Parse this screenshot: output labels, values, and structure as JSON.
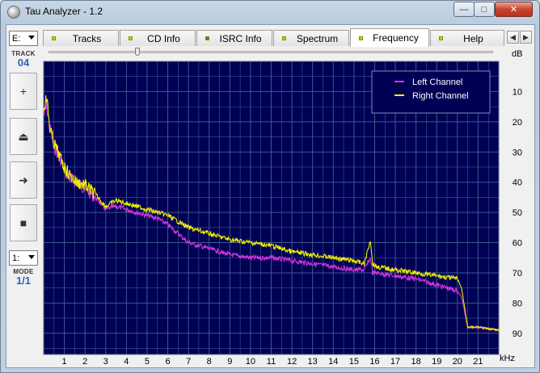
{
  "window": {
    "title": "Tau Analyzer - 1.2"
  },
  "left_panel": {
    "drive": "E:",
    "track_label": "TRACK",
    "track_value": "04",
    "buttons": [
      {
        "name": "plus",
        "glyph": "+"
      },
      {
        "name": "eject",
        "glyph": "⏏"
      },
      {
        "name": "next",
        "glyph": "➜"
      },
      {
        "name": "stop",
        "glyph": "■"
      }
    ],
    "mode_select": "1:",
    "mode_label": "MODE",
    "mode_value": "1/1"
  },
  "tabs": [
    {
      "label": "Tracks",
      "led": "#c8d000",
      "active": false
    },
    {
      "label": "CD Info",
      "led": "#c8d000",
      "active": false
    },
    {
      "label": "ISRC Info",
      "led": "#666666",
      "active": false
    },
    {
      "label": "Spectrum",
      "led": "#c8d000",
      "active": false
    },
    {
      "label": "Frequency",
      "led": "#c8d000",
      "active": true
    },
    {
      "label": "Help",
      "led": "#c8d000",
      "active": false
    }
  ],
  "slider": {
    "value": 0.2
  },
  "chart_data": {
    "type": "line",
    "xlabel": "kHz",
    "ylabel": "dB",
    "xlim": [
      0,
      22
    ],
    "ylim": [
      0,
      97
    ],
    "y_inverted": true,
    "x_ticks": [
      1,
      2,
      3,
      4,
      5,
      6,
      7,
      8,
      9,
      10,
      11,
      12,
      13,
      14,
      15,
      16,
      17,
      18,
      19,
      20,
      21
    ],
    "y_ticks": [
      10,
      20,
      30,
      40,
      50,
      60,
      70,
      80,
      90
    ],
    "grid": true,
    "legend": "top-right",
    "background": "#000055",
    "series": [
      {
        "name": "Left Channel",
        "color": "#d535e0",
        "x": [
          0,
          0.15,
          0.3,
          0.5,
          0.8,
          1.0,
          1.3,
          1.6,
          2.0,
          2.5,
          3.0,
          3.5,
          4.0,
          4.5,
          5.0,
          5.5,
          6.0,
          6.5,
          7.0,
          7.5,
          8.0,
          9.0,
          10.0,
          11.0,
          12.0,
          13.0,
          14.0,
          15.0,
          15.5,
          15.8,
          15.9,
          16.1,
          17.0,
          18.0,
          19.0,
          20.0,
          20.2,
          20.5,
          21.0,
          22.0
        ],
        "y": [
          18,
          15,
          22,
          28,
          32,
          36,
          39,
          40,
          42,
          45,
          49,
          48,
          49,
          50,
          51,
          52,
          54,
          57,
          60,
          61,
          62,
          64,
          65,
          65,
          66,
          67,
          68,
          69,
          69,
          65,
          70,
          70,
          71,
          72,
          74,
          76,
          78,
          88,
          88,
          89
        ]
      },
      {
        "name": "Right Channel",
        "color": "#f0f000",
        "x": [
          0,
          0.15,
          0.3,
          0.5,
          0.8,
          1.0,
          1.3,
          1.6,
          2.0,
          2.5,
          3.0,
          3.5,
          4.0,
          4.5,
          5.0,
          5.5,
          6.0,
          6.5,
          7.0,
          7.5,
          8.0,
          9.0,
          10.0,
          11.0,
          12.0,
          13.0,
          14.0,
          15.0,
          15.5,
          15.8,
          15.9,
          16.1,
          17.0,
          18.0,
          19.0,
          20.0,
          20.2,
          20.5,
          21.0,
          22.0
        ],
        "y": [
          15,
          12,
          22,
          27,
          32,
          35,
          38,
          40,
          41,
          44,
          48,
          46,
          47,
          48,
          49,
          50,
          51,
          53,
          55,
          56,
          57,
          59,
          60,
          61,
          63,
          64,
          65,
          66,
          67,
          59,
          67,
          68,
          69,
          70,
          71,
          72,
          75,
          88,
          88,
          89
        ]
      }
    ]
  }
}
